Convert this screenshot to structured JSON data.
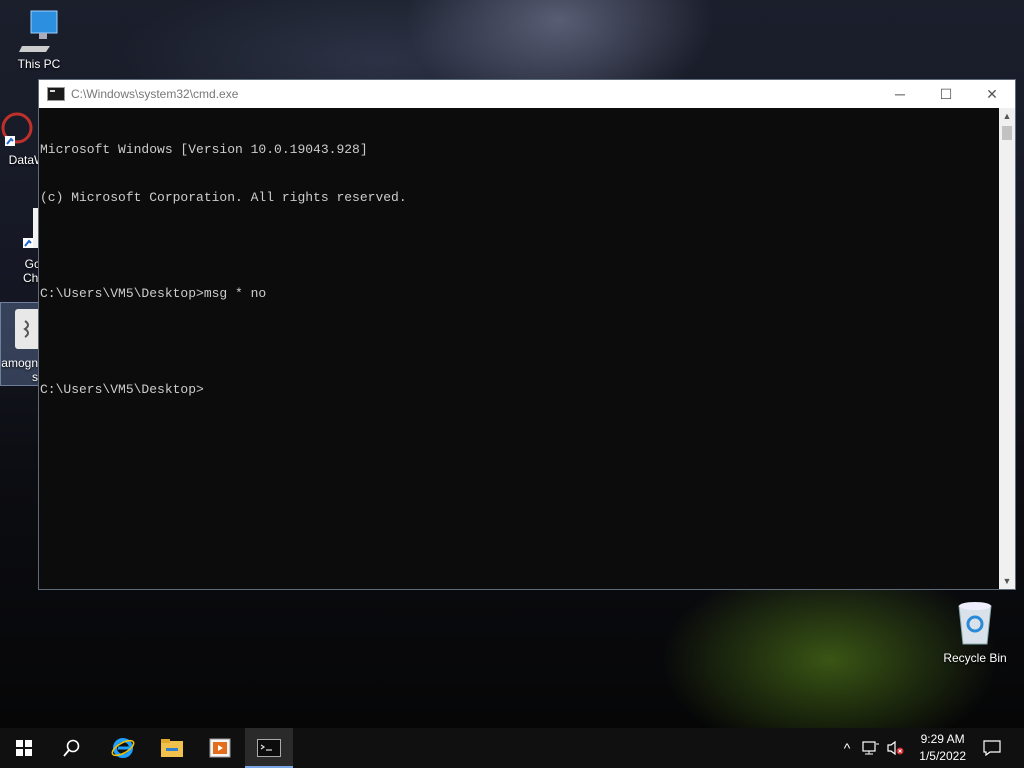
{
  "desktop": {
    "icons": [
      {
        "label": "This PC",
        "icon": "computer-icon"
      },
      {
        "label": "DataW",
        "icon": "app-shortcut-icon"
      },
      {
        "label": "Goo\nChro",
        "icon": "chrome-shortcut-icon"
      },
      {
        "label": "amogn\ns",
        "icon": "java-file-icon"
      },
      {
        "label": "Recycle Bin",
        "icon": "recycle-bin-icon"
      }
    ]
  },
  "window": {
    "title": "C:\\Windows\\system32\\cmd.exe",
    "controls": {
      "minimize": "─",
      "maximize": "☐",
      "close": "✕"
    }
  },
  "console": {
    "lines": [
      "Microsoft Windows [Version 10.0.19043.928]",
      "(c) Microsoft Corporation. All rights reserved.",
      "",
      "C:\\Users\\VM5\\Desktop>msg * no",
      "",
      "C:\\Users\\VM5\\Desktop>"
    ]
  },
  "taskbar": {
    "start": "windows-start-icon",
    "search": "search-icon",
    "pinned": [
      "internet-explorer-icon",
      "file-explorer-icon",
      "media-player-icon",
      "cmd-icon"
    ],
    "tray": {
      "chevron": "^",
      "network": "network-icon",
      "volume": "volume-muted-icon"
    },
    "time": "9:29 AM",
    "date": "1/5/2022"
  }
}
